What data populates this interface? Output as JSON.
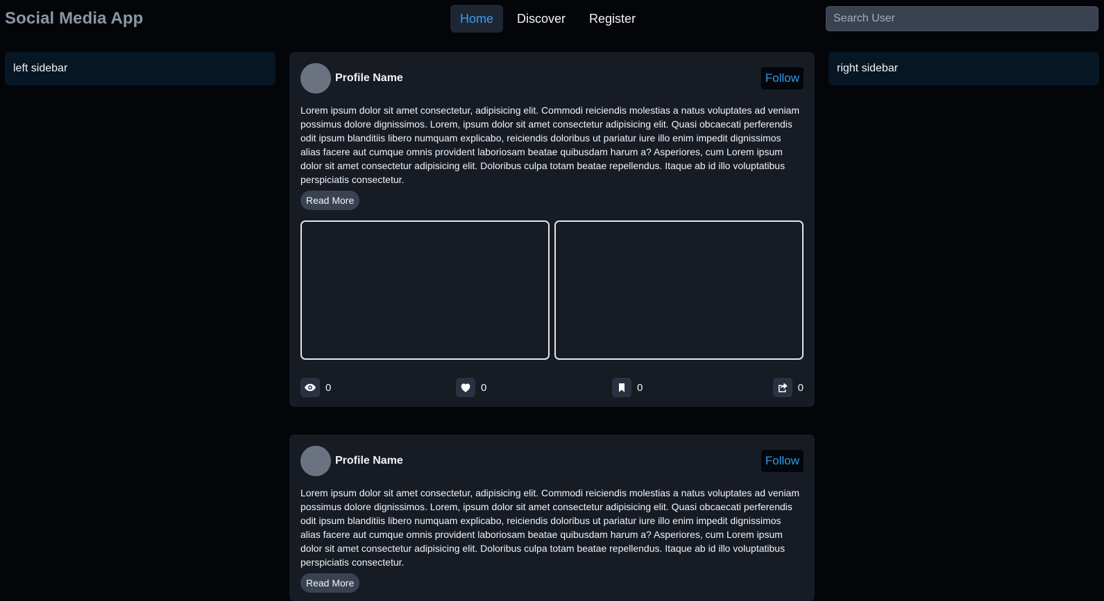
{
  "header": {
    "brand": "Social Media App",
    "nav": [
      {
        "label": "Home",
        "active": true
      },
      {
        "label": "Discover",
        "active": false
      },
      {
        "label": "Register",
        "active": false
      }
    ],
    "search": {
      "placeholder": "Search User",
      "value": ""
    }
  },
  "sidebars": {
    "left": "left sidebar",
    "right": "right sidebar"
  },
  "posts": [
    {
      "profile_name": "Profile Name",
      "follow_label": "Follow",
      "text": "Lorem ipsum dolor sit amet consectetur, adipisicing elit. Commodi reiciendis molestias a natus voluptates ad veniam possimus dolore dignissimos. Lorem, ipsum dolor sit amet consectetur adipisicing elit. Quasi obcaecati perferendis odit ipsum blanditiis libero numquam explicabo, reiciendis doloribus ut pariatur iure illo enim impedit dignissimos alias facere aut cumque omnis provident laboriosam beatae quibusdam harum a? Asperiores, cum Lorem ipsum dolor sit amet consectetur adipisicing elit. Doloribus culpa totam beatae repellendus. Itaque ab id illo voluptatibus perspiciatis consectetur.",
      "read_more_label": "Read More",
      "stats": {
        "views": "0",
        "likes": "0",
        "bookmarks": "0",
        "shares": "0"
      }
    },
    {
      "profile_name": "Profile Name",
      "follow_label": "Follow",
      "text": "Lorem ipsum dolor sit amet consectetur, adipisicing elit. Commodi reiciendis molestias a natus voluptates ad veniam possimus dolore dignissimos. Lorem, ipsum dolor sit amet consectetur adipisicing elit. Quasi obcaecati perferendis odit ipsum blanditiis libero numquam explicabo, reiciendis doloribus ut pariatur iure illo enim impedit dignissimos alias facere aut cumque omnis provident laboriosam beatae quibusdam harum a? Asperiores, cum Lorem ipsum dolor sit amet consectetur adipisicing elit. Doloribus culpa totam beatae repellendus. Itaque ab id illo voluptatibus perspiciatis consectetur.",
      "read_more_label": "Read More"
    }
  ],
  "icons": {
    "views": "eye-icon",
    "likes": "heart-icon",
    "bookmarks": "bookmark-icon",
    "shares": "share-icon"
  },
  "colors": {
    "background": "#030508",
    "card": "#161b24",
    "accent": "#3b9cf0",
    "follow_text": "#2f9be8"
  }
}
